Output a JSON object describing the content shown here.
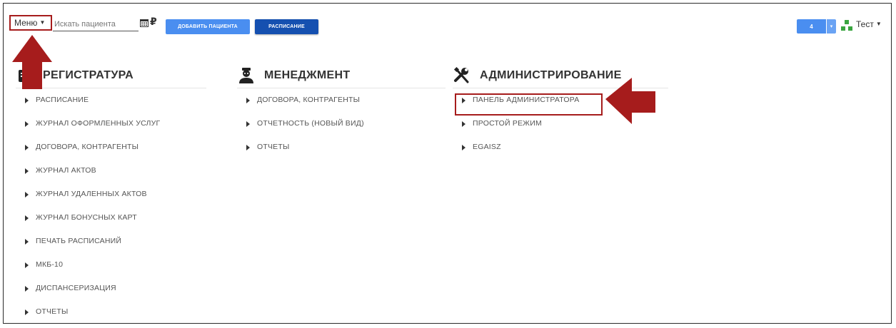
{
  "topbar": {
    "menu_label": "Меню",
    "search_placeholder": "Искать пациента",
    "calendar_icon": "calendar-icon",
    "ruble_symbol": "₽",
    "add_patient_label": "ДОБАВИТЬ ПАЦИЕНТА",
    "schedule_label": "РАСПИСАНИЕ",
    "counter_value": "4",
    "user_name": "Тест"
  },
  "columns": [
    {
      "title": "РЕГИСТРАТУРА",
      "icon": "registry-icon",
      "items": [
        "РАСПИСАНИЕ",
        "ЖУРНАЛ ОФОРМЛЕННЫХ УСЛУГ",
        "ДОГОВОРА, КОНТРАГЕНТЫ",
        "ЖУРНАЛ АКТОВ",
        "ЖУРНАЛ УДАЛЕННЫХ АКТОВ",
        "ЖУРНАЛ БОНУСНЫХ КАРТ",
        "ПЕЧАТЬ РАСПИСАНИЙ",
        "МКБ-10",
        "ДИСПАНСЕРИЗАЦИЯ",
        "ОТЧЕТЫ"
      ]
    },
    {
      "title": "МЕНЕДЖМЕНТ",
      "icon": "manager-icon",
      "items": [
        "ДОГОВОРА, КОНТРАГЕНТЫ",
        "ОТЧЕТНОСТЬ (НОВЫЙ ВИД)",
        "ОТЧЕТЫ"
      ]
    },
    {
      "title": "АДМИНИСТРИРОВАНИЕ",
      "icon": "tools-icon",
      "items": [
        "ПАНЕЛЬ АДМИНИСТРАТОРА",
        "ПРОСТОЙ РЕЖИМ",
        "EGAISZ"
      ]
    }
  ],
  "colors": {
    "primary_button": "#4a8ef0",
    "dark_button": "#1550b0",
    "annotation_red": "#a61c1c"
  }
}
